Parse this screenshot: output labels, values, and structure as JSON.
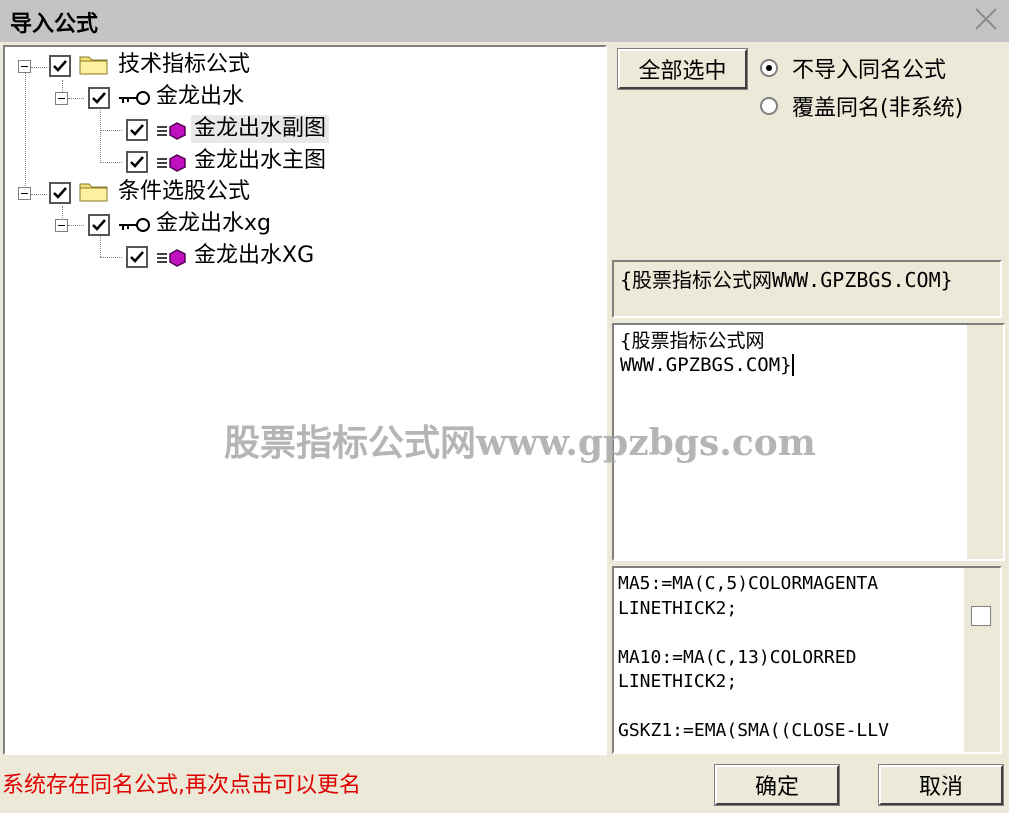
{
  "window": {
    "title": "导入公式"
  },
  "tree": {
    "groups": [
      {
        "label": "技术指标公式",
        "child": {
          "label": "金龙出水",
          "leaves": [
            "金龙出水副图",
            "金龙出水主图"
          ]
        }
      },
      {
        "label": "条件选股公式",
        "child": {
          "label": "金龙出水xg",
          "leaves": [
            "金龙出水XG"
          ]
        }
      }
    ]
  },
  "buttons": {
    "select_all": "全部选中",
    "ok": "确定",
    "cancel": "取消"
  },
  "options": {
    "no_import_same_name": "不导入同名公式",
    "overwrite_same_name": "覆盖同名(非系统)",
    "selected": "no_import_same_name"
  },
  "description": "{股票指标公式网WWW.GPZBGS.COM}",
  "editor": {
    "line1": "{股票指标公式网",
    "line2": "WWW.GPZBGS.COM}"
  },
  "code_preview": "MA5:=MA(C,5)COLORMAGENTA\nLINETHICK2;\n\nMA10:=MA(C,13)COLORRED\nLINETHICK2;\n\nGSKZ1:=EMA(SMA((CLOSE-LLV",
  "status": "系统存在同名公式,再次点击可以更名",
  "watermark": "股票指标公式网www.gpzbgs.com"
}
